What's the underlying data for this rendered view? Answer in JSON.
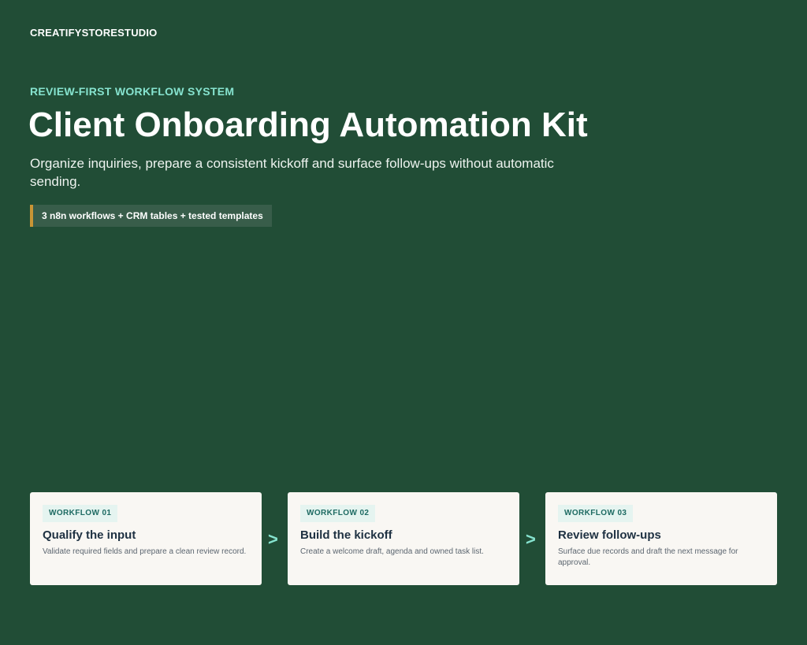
{
  "brand": "CREATIFYSTORESTUDIO",
  "hero": {
    "eyebrow": "REVIEW-FIRST WORKFLOW SYSTEM",
    "title": "Client Onboarding Automation Kit",
    "subtitle": "Organize inquiries, prepare a consistent kickoff and surface follow-ups without automatic sending.",
    "pill": "3 n8n workflows + CRM tables + tested templates"
  },
  "arrow_glyph": ">",
  "workflows": [
    {
      "badge": "WORKFLOW 01",
      "title": "Qualify the input",
      "description": "Validate required fields and prepare a clean review record."
    },
    {
      "badge": "WORKFLOW 02",
      "title": "Build the kickoff",
      "description": "Create a welcome draft, agenda and owned task list."
    },
    {
      "badge": "WORKFLOW 03",
      "title": "Review follow-ups",
      "description": "Surface due records and draft the next message for approval."
    }
  ],
  "colors": {
    "background": "#214d36",
    "accent": "#86e3cf",
    "pill_border": "#c99535",
    "card_background": "#f9f7f3"
  }
}
